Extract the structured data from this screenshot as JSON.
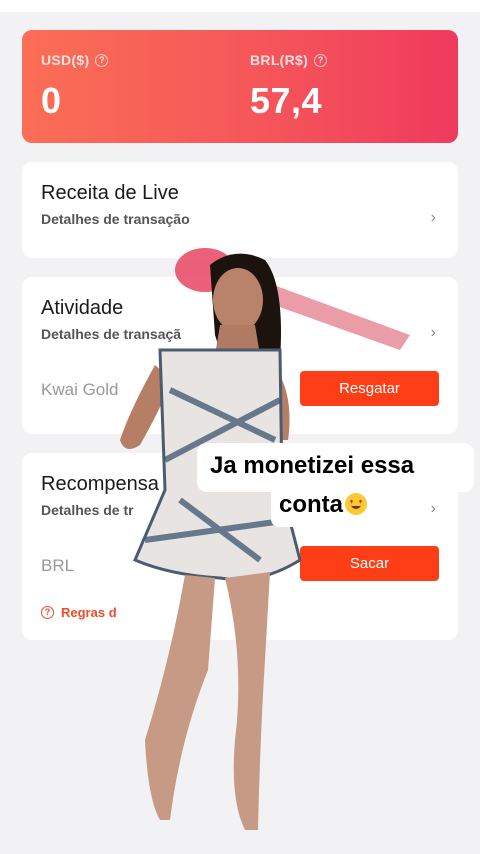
{
  "balance": {
    "usd_label": "USD($)",
    "usd_value": "0",
    "brl_label": "BRL(R$)",
    "brl_value": "57,4"
  },
  "cards": {
    "live": {
      "title": "Receita de Live",
      "subtitle": "Detalhes de transação"
    },
    "activity": {
      "title": "Atividade",
      "subtitle": "Detalhes de transaçã",
      "row_label": "Kwai Gold",
      "button": "Resgatar"
    },
    "rewards": {
      "title": "Recompensa",
      "subtitle": "Detalhes de tr",
      "row_label": "BRL",
      "button": "Sacar",
      "rules_link": "Regras d"
    }
  },
  "overlay": {
    "caption_line1": "Ja monetizei essa",
    "caption_line2": "conta",
    "emoji": "heart-eyes-emoji"
  },
  "icons": {
    "help": "help-circle-icon",
    "chevron": "chevron-right-icon"
  },
  "colors": {
    "gradient_start": "#fb6e55",
    "gradient_end": "#ef3a5d",
    "button": "#fe3e16",
    "rules_text": "#f24a2a",
    "background": "#f2f2f4"
  }
}
